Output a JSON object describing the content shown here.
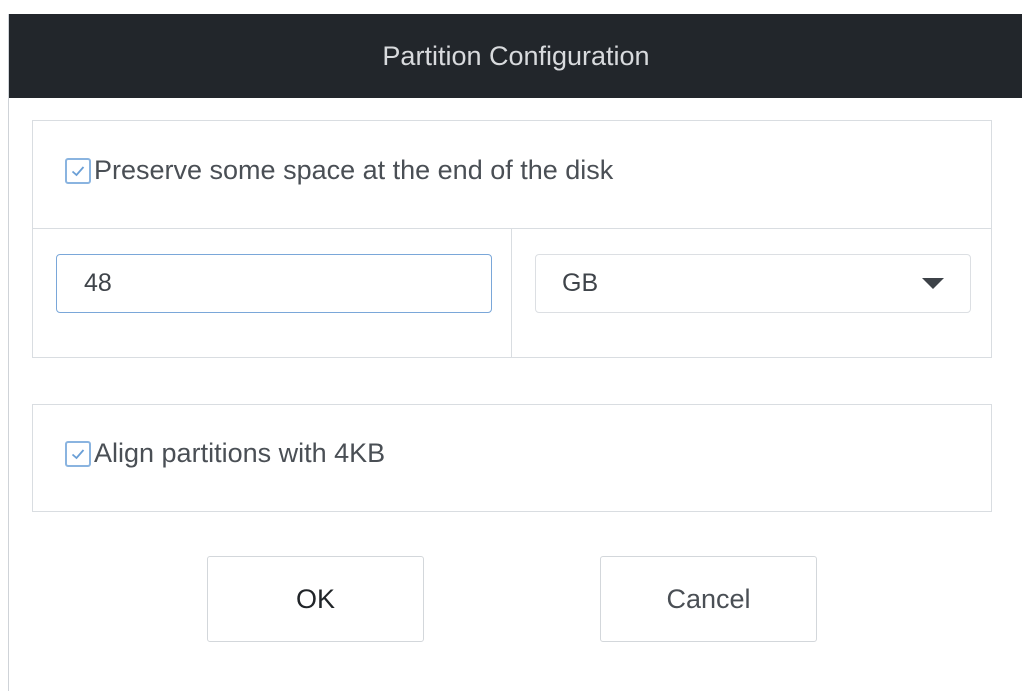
{
  "dialog": {
    "title": "Partition Configuration"
  },
  "preserve": {
    "checked": true,
    "label": "Preserve some space at the end of the disk",
    "size_value": "48",
    "unit_selected": "GB",
    "unit_icon": "chevron-down-icon"
  },
  "align": {
    "checked": true,
    "label": "Align partitions with 4KB"
  },
  "buttons": {
    "ok_label": "OK",
    "cancel_label": "Cancel"
  },
  "colors": {
    "titlebar_bg": "#22262b",
    "accent_border": "#7aa7d9"
  }
}
